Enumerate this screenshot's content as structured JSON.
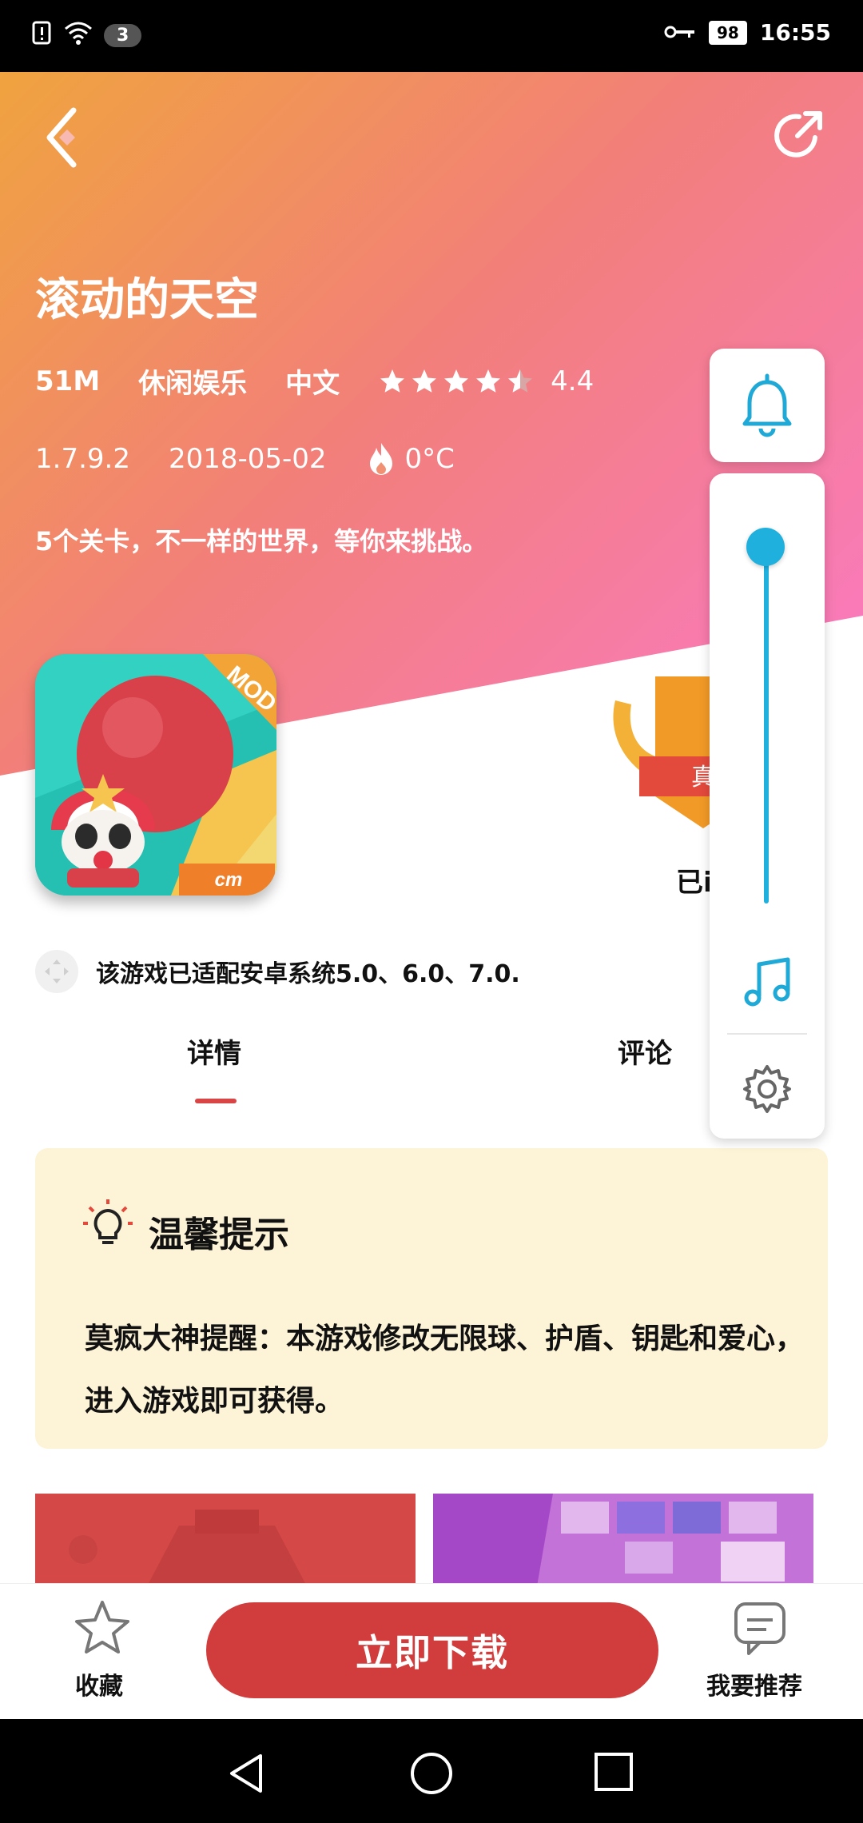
{
  "status_bar": {
    "notif_count": "3",
    "battery": "98",
    "time": "16:55"
  },
  "game": {
    "title": "滚动的天空",
    "size": "51M",
    "category": "休闲娱乐",
    "language": "中文",
    "rating": "4.4",
    "rating_stars": 4.5,
    "version": "1.7.9.2",
    "date": "2018-05-02",
    "heat": "0°C",
    "description": "5个关卡，不一样的世界，等你来挑战。",
    "icon_corner_label": "MOD"
  },
  "badge": {
    "ribbon_text": "真",
    "caption": "已i"
  },
  "compat": {
    "text": "该游戏已适配安卓系统5.0、6.0、7.0."
  },
  "tabs": [
    {
      "label": "详情"
    },
    {
      "label": "评论"
    }
  ],
  "tip": {
    "title": "温馨提示",
    "text": "莫疯大神提醒：本游戏修改无限球、护盾、钥匙和爱心，进入游戏即可获得。"
  },
  "bottom_bar": {
    "favorite_label": "收藏",
    "download_label": "立即下载",
    "recommend_label": "我要推荐"
  },
  "colors": {
    "accent_red": "#d13d3d",
    "slider_blue": "#1fb0de",
    "tip_background": "#fdf3d6",
    "hero_gradient": [
      "#f0a33f",
      "#f27f7a",
      "#fb79c8"
    ]
  },
  "volume_level": 0.97
}
